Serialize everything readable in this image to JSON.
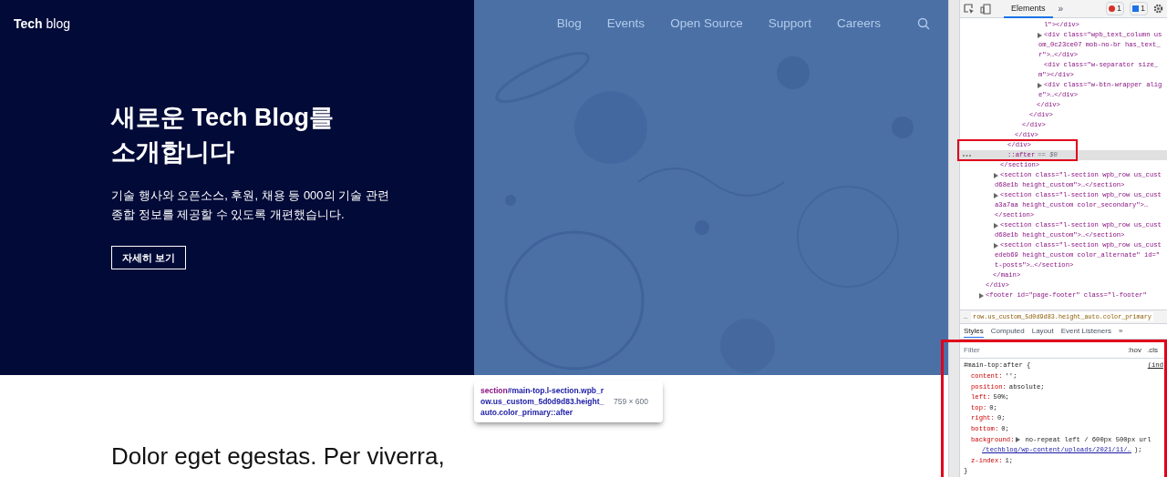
{
  "site": {
    "logo": "**Tech** blog",
    "nav": [
      {
        "label": "Blog"
      },
      {
        "label": "Events"
      },
      {
        "label": "Open Source"
      },
      {
        "label": "Support"
      },
      {
        "label": "Careers"
      }
    ],
    "hero": {
      "title_lines": [
        "새로운 Tech Blog를",
        "소개합니다"
      ],
      "description_lines": [
        "기술 행사와 오픈소스, 후원, 채용 등 000의 기술 관련",
        "종합 정보를 제공할 수 있도록 개편했습니다."
      ],
      "button": "자세히 보기"
    },
    "body_text": "Dolor eget egestas. Per viverra,"
  },
  "inspector_tooltip": {
    "tag": "section",
    "selector": "#main-top.l-section.wpb_row.us_custom_5d0d9d83.height_auto.color_primary::after",
    "size": "759 × 600"
  },
  "devtools": {
    "tabs": [
      {
        "label": "Elements",
        "selected": true
      }
    ],
    "more": "»",
    "errors": "1",
    "messages": "1",
    "tree": [
      {
        "children": [
          {
            "children": [
              {
                "children": [
                  {
                    "children": [
                      {
                        "children": [
                          {
                            "children": [
                              {
                                "children": [
                                  {
                                    "children": [
                                      {
                                        "lines": [
                                          "l\"></div>"
                                        ]
                                      },
                                      {
                                        "lines": [
                                          "<div class=\"wpb_text_column us",
                                          "om_0c23ce07 mob-no-br has_text_",
                                          "r\">…</div>"
                                        ],
                                        "expandable": true
                                      },
                                      {
                                        "lines": [
                                          "<div class=\"w-separator size_",
                                          "m\"></div>"
                                        ]
                                      },
                                      {
                                        "lines": [
                                          "<div class=\"w-btn-wrapper alig",
                                          "e\">…</div>"
                                        ],
                                        "expandable": true
                                      }
                                    ]
                                  },
                                  {
                                    "lines": [
                                      "</div>"
                                    ]
                                  }
                                ]
                              },
                              {
                                "lines": [
                                  "</div>"
                                ]
                              }
                            ]
                          },
                          {
                            "lines": [
                              "</div>"
                            ]
                          }
                        ]
                      },
                      {
                        "lines": [
                          "</div>"
                        ]
                      }
                    ]
                  },
                  {
                    "lines": [
                      "</div>"
                    ]
                  },
                  {
                    "lines": [
                      "::after"
                    ],
                    "selected": true,
                    "suffix": "== $0"
                  }
                ]
              },
              {
                "lines": [
                  "</section>"
                ]
              },
              {
                "lines": [
                  "<section class=\"l-section wpb_row us_cust",
                  "d68e1b height_custom\">…</section>"
                ],
                "expandable": true
              },
              {
                "lines": [
                  "<section class=\"l-section wpb_row us_cust",
                  "a3a7aa height_custom color_secondary\">…",
                  "</section>"
                ],
                "expandable": true
              },
              {
                "lines": [
                  "<section class=\"l-section wpb_row us_cust",
                  "d68e1b height_custom\">…</section>"
                ],
                "expandable": true
              },
              {
                "lines": [
                  "<section class=\"l-section wpb_row us_cust",
                  "edeb69 height_custom color_alternate\" id=\"",
                  "t-posts\">…</section>"
                ],
                "expandable": true
              }
            ]
          },
          {
            "lines": [
              "</main>"
            ]
          }
        ]
      },
      {
        "lines": [
          "</div>"
        ]
      },
      {
        "lines": [
          "<footer id=\"page-footer\" class=\"l-footer\""
        ],
        "expandable": true
      }
    ],
    "breadcrumb": [
      "…",
      "row.us_custom_5d0d9d83.height_auto.color_primary"
    ],
    "style_tabs": [
      {
        "label": "Styles",
        "selected": true
      },
      {
        "label": "Computed",
        "selected": false
      },
      {
        "label": "Layout",
        "selected": false
      },
      {
        "label": "Event Listeners",
        "selected": false
      }
    ],
    "filter": {
      "placeholder": "Filter"
    },
    "hov": ":hov",
    "cls": ".cls",
    "rule": {
      "selector": "#main-top:after {",
      "source": "(ind",
      "close": "}",
      "props": [
        {
          "name": "content:",
          "value": "'';"
        },
        {
          "name": "position:",
          "value": "absolute;"
        },
        {
          "name": "left:",
          "value": "50%;"
        },
        {
          "name": "top:",
          "value": "0;"
        },
        {
          "name": "right:",
          "value": "0;"
        },
        {
          "name": "bottom:",
          "value": "0;"
        },
        {
          "name": "background:",
          "value": "no-repeat left / 600px 500px url",
          "expandable": true,
          "link": "/techblog/wp-content/uploads/2021/11/…",
          "tail": ");"
        },
        {
          "name": "z-index:",
          "value": "1;"
        }
      ]
    }
  }
}
